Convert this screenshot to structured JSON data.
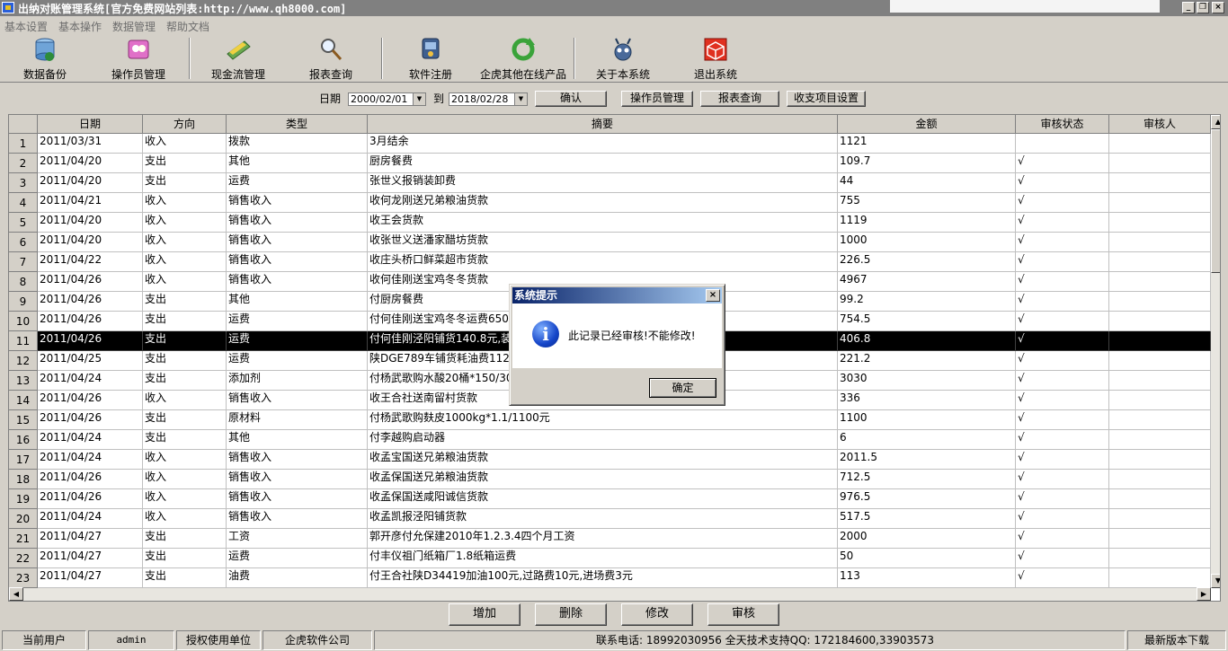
{
  "window": {
    "title": "出纳对账管理系统[官方免费网站列表:http://www.qh8000.com]",
    "minimize": "_",
    "restore": "❐",
    "close": "×"
  },
  "menu": [
    "基本设置",
    "基本操作",
    "数据管理",
    "帮助文档"
  ],
  "toolbar": {
    "backup": "数据备份",
    "operators": "操作员管理",
    "cashflow": "现金流管理",
    "report": "报表查询",
    "register": "软件注册",
    "products": "企虎其他在线产品",
    "about": "关于本系统",
    "exit": "退出系统"
  },
  "filter": {
    "date_label": "日期",
    "date_from": "2000/02/01",
    "to_label": "到",
    "date_to": "2018/02/28",
    "confirm": "确认",
    "operators": "操作员管理",
    "report": "报表查询",
    "items": "收支项目设置"
  },
  "table": {
    "columns": [
      "日期",
      "方向",
      "类型",
      "摘要",
      "金额",
      "审核状态",
      "审核人"
    ],
    "rows": [
      {
        "n": "1",
        "date": "2011/03/31",
        "dir": "收入",
        "type": "拨款",
        "memo": "3月结余",
        "amount": "1121",
        "status": "",
        "auditor": ""
      },
      {
        "n": "2",
        "date": "2011/04/20",
        "dir": "支出",
        "type": "其他",
        "memo": "厨房餐费",
        "amount": "109.7",
        "status": "√",
        "auditor": ""
      },
      {
        "n": "3",
        "date": "2011/04/20",
        "dir": "支出",
        "type": "运费",
        "memo": "张世义报销装卸费",
        "amount": "44",
        "status": "√",
        "auditor": ""
      },
      {
        "n": "4",
        "date": "2011/04/21",
        "dir": "收入",
        "type": "销售收入",
        "memo": "收何龙刚送兄弟粮油货款",
        "amount": "755",
        "status": "√",
        "auditor": ""
      },
      {
        "n": "5",
        "date": "2011/04/20",
        "dir": "收入",
        "type": "销售收入",
        "memo": "收王会货款",
        "amount": "1119",
        "status": "√",
        "auditor": ""
      },
      {
        "n": "6",
        "date": "2011/04/20",
        "dir": "收入",
        "type": "销售收入",
        "memo": "收张世义送潘家醋坊货款",
        "amount": "1000",
        "status": "√",
        "auditor": ""
      },
      {
        "n": "7",
        "date": "2011/04/22",
        "dir": "收入",
        "type": "销售收入",
        "memo": "收庄头桥口鲜菜超市货款",
        "amount": "226.5",
        "status": "√",
        "auditor": ""
      },
      {
        "n": "8",
        "date": "2011/04/26",
        "dir": "收入",
        "type": "销售收入",
        "memo": "收何佳刚送宝鸡冬冬货款",
        "amount": "4967",
        "status": "√",
        "auditor": ""
      },
      {
        "n": "9",
        "date": "2011/04/26",
        "dir": "支出",
        "type": "其他",
        "memo": "付厨房餐费",
        "amount": "99.2",
        "status": "√",
        "auditor": ""
      },
      {
        "n": "10",
        "date": "2011/04/26",
        "dir": "支出",
        "type": "运费",
        "memo": "付何佳刚送宝鸡冬冬运费650元",
        "amount": "754.5",
        "status": "√",
        "auditor": ""
      },
      {
        "n": "11",
        "date": "2011/04/26",
        "dir": "支出",
        "type": "运费",
        "memo": "付何佳刚泾阳铺货140.8元,装卸",
        "amount": "406.8",
        "status": "√",
        "auditor": ""
      },
      {
        "n": "12",
        "date": "2011/04/25",
        "dir": "支出",
        "type": "运费",
        "memo": "陕DGE789车铺货耗油费112元",
        "amount": "221.2",
        "status": "√",
        "auditor": ""
      },
      {
        "n": "13",
        "date": "2011/04/24",
        "dir": "支出",
        "type": "添加剂",
        "memo": "付杨武歌购水酸20桶*150/3000",
        "amount": "3030",
        "status": "√",
        "auditor": ""
      },
      {
        "n": "14",
        "date": "2011/04/26",
        "dir": "收入",
        "type": "销售收入",
        "memo": "收王合社送南留村货款",
        "amount": "336",
        "status": "√",
        "auditor": ""
      },
      {
        "n": "15",
        "date": "2011/04/26",
        "dir": "支出",
        "type": "原材料",
        "memo": "付杨武歌购麸皮1000kg*1.1/1100元",
        "amount": "1100",
        "status": "√",
        "auditor": ""
      },
      {
        "n": "16",
        "date": "2011/04/24",
        "dir": "支出",
        "type": "其他",
        "memo": "付李越购启动器",
        "amount": "6",
        "status": "√",
        "auditor": ""
      },
      {
        "n": "17",
        "date": "2011/04/24",
        "dir": "收入",
        "type": "销售收入",
        "memo": "收孟宝国送兄弟粮油货款",
        "amount": "2011.5",
        "status": "√",
        "auditor": ""
      },
      {
        "n": "18",
        "date": "2011/04/26",
        "dir": "收入",
        "type": "销售收入",
        "memo": "收孟保国送兄弟粮油货款",
        "amount": "712.5",
        "status": "√",
        "auditor": ""
      },
      {
        "n": "19",
        "date": "2011/04/26",
        "dir": "收入",
        "type": "销售收入",
        "memo": "收孟保国送咸阳诚信货款",
        "amount": "976.5",
        "status": "√",
        "auditor": ""
      },
      {
        "n": "20",
        "date": "2011/04/24",
        "dir": "收入",
        "type": "销售收入",
        "memo": "收孟凯报泾阳铺货款",
        "amount": "517.5",
        "status": "√",
        "auditor": ""
      },
      {
        "n": "21",
        "date": "2011/04/27",
        "dir": "支出",
        "type": "工资",
        "memo": "郭开彦付允保建2010年1.2.3.4四个月工资",
        "amount": "2000",
        "status": "√",
        "auditor": ""
      },
      {
        "n": "22",
        "date": "2011/04/27",
        "dir": "支出",
        "type": "运费",
        "memo": "付丰仪祖门纸箱厂1.8纸箱运费",
        "amount": "50",
        "status": "√",
        "auditor": ""
      },
      {
        "n": "23",
        "date": "2011/04/27",
        "dir": "支出",
        "type": "油费",
        "memo": "付王合社陕D34419加油100元,过路费10元,进场费3元",
        "amount": "113",
        "status": "√",
        "auditor": ""
      }
    ]
  },
  "actions": {
    "add": "增加",
    "delete": "删除",
    "edit": "修改",
    "audit": "审核"
  },
  "status": {
    "user_label": "当前用户",
    "user": "admin",
    "unit_label": "授权使用单位",
    "unit": "企虎软件公司",
    "contact": "联系电话: 18992030956  全天技术支持QQ: 172184600,33903573",
    "download": "最新版本下载"
  },
  "dialog": {
    "title": "系统提示",
    "message": "此记录已经审核!不能修改!",
    "ok": "确定",
    "close": "×",
    "icon": "i"
  }
}
